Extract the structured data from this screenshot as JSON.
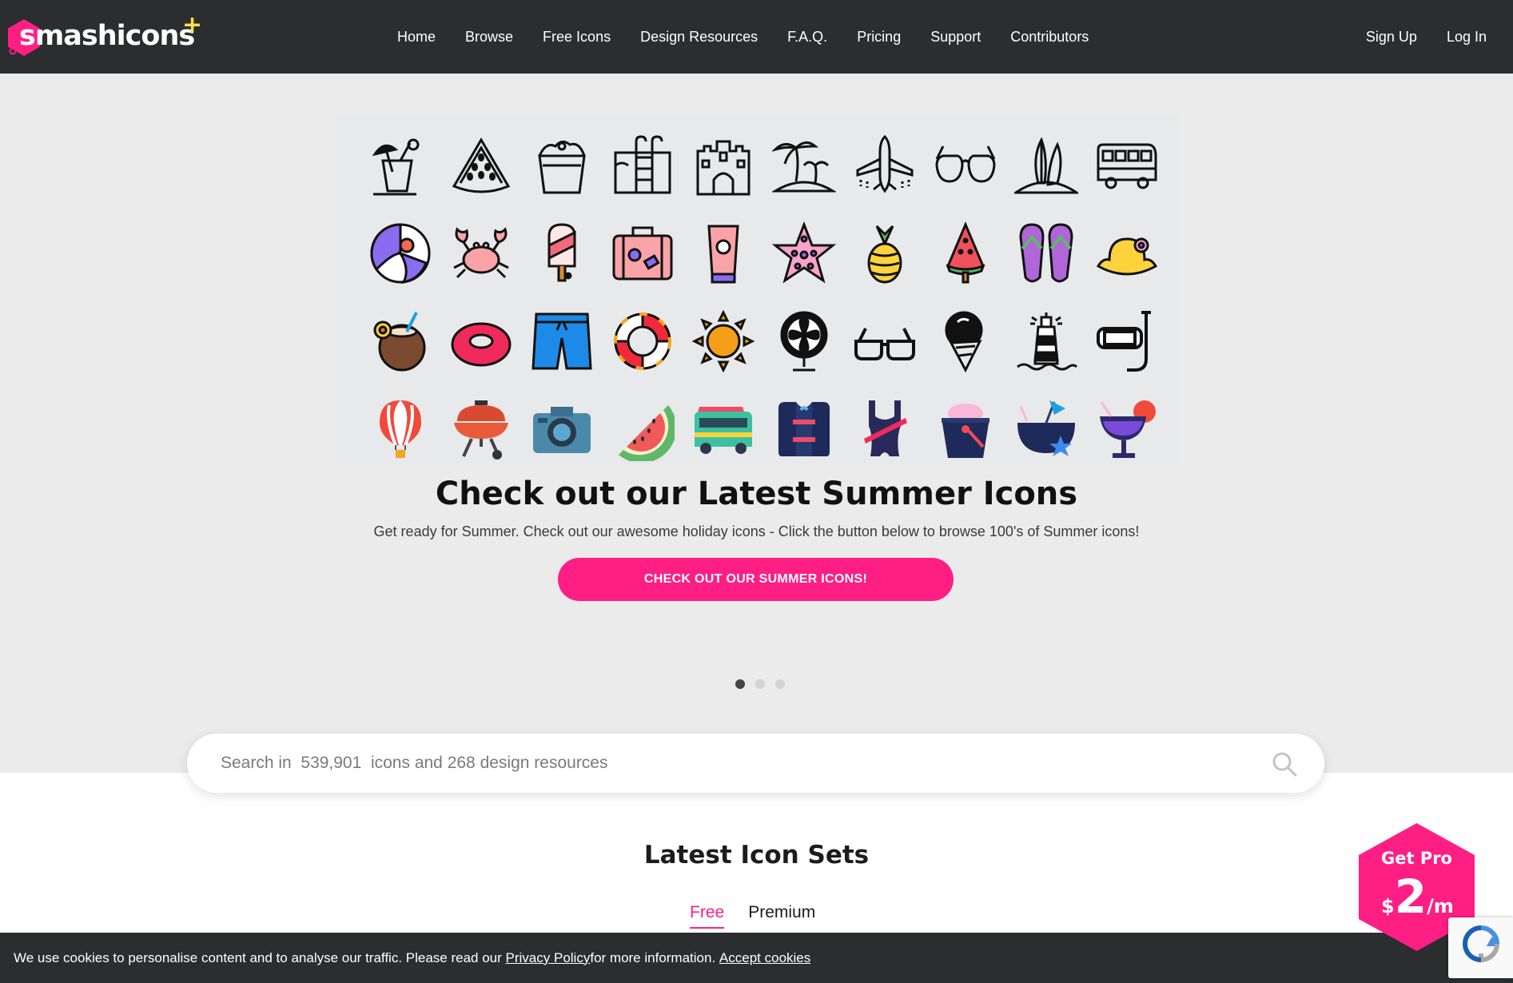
{
  "header": {
    "logo_text": "smashicons",
    "logo_plus": "+",
    "nav": [
      "Home",
      "Browse",
      "Free Icons",
      "Design Resources",
      "F.A.Q.",
      "Pricing",
      "Support",
      "Contributors"
    ],
    "auth": [
      "Sign Up",
      "Log In"
    ]
  },
  "hero": {
    "title": "Check out our Latest Summer Icons",
    "subtitle": "Get ready for Summer. Check out our awesome holiday icons - Click the button below to browse 100's of Summer icons!",
    "cta_label": "CHECK OUT OUR SUMMER ICONS!",
    "slides": 3,
    "active_slide": 1,
    "icon_rows": [
      [
        "cocktail-icon",
        "watermelon-slice-icon",
        "sand-bucket-icon",
        "swimming-pool-icon",
        "sand-castle-icon",
        "palm-island-icon",
        "airplane-icon",
        "sunglasses-icon",
        "surfboard-island-icon",
        "camper-van-icon"
      ],
      [
        "beach-ball-icon",
        "crab-icon",
        "popsicle-icon",
        "suitcase-icon",
        "sunscreen-icon",
        "starfish-icon",
        "pineapple-icon",
        "watermelon-popsicle-icon",
        "flip-flops-icon",
        "sun-hat-icon"
      ],
      [
        "coconut-drink-icon",
        "swim-ring-icon",
        "swim-shorts-icon",
        "lifebuoy-icon",
        "sun-icon",
        "fan-icon",
        "sunglasses-icon",
        "ice-cream-icon",
        "lighthouse-icon",
        "snorkel-mask-icon"
      ],
      [
        "hot-air-balloon-icon",
        "barbecue-grill-icon",
        "camera-icon",
        "watermelon-icon",
        "surf-van-icon",
        "life-vest-icon",
        "swimsuit-icon",
        "sand-bucket-icon",
        "coconut-cocktail-icon",
        "tropical-drink-icon"
      ]
    ]
  },
  "search": {
    "placeholder": "Search in  539,901  icons and 268 design resources"
  },
  "latest": {
    "title": "Latest Icon Sets",
    "tabs": [
      "Free",
      "Premium"
    ],
    "active_tab": "Free"
  },
  "cookie": {
    "text_before": "We use cookies to personalise content and to analyse our traffic. Please read our ",
    "policy_link": "Privacy Policy",
    "text_after": " for more information. ",
    "accept_link": "Accept cookies"
  },
  "pro_badge": {
    "label": "Get Pro",
    "currency": "$",
    "price": "2",
    "period": "/m"
  },
  "colors": {
    "brand_pink": "#ff1e83",
    "header_bg": "#2b2d2e",
    "hero_bg": "#ebebeb",
    "logo_plus": "#f7e04a"
  }
}
